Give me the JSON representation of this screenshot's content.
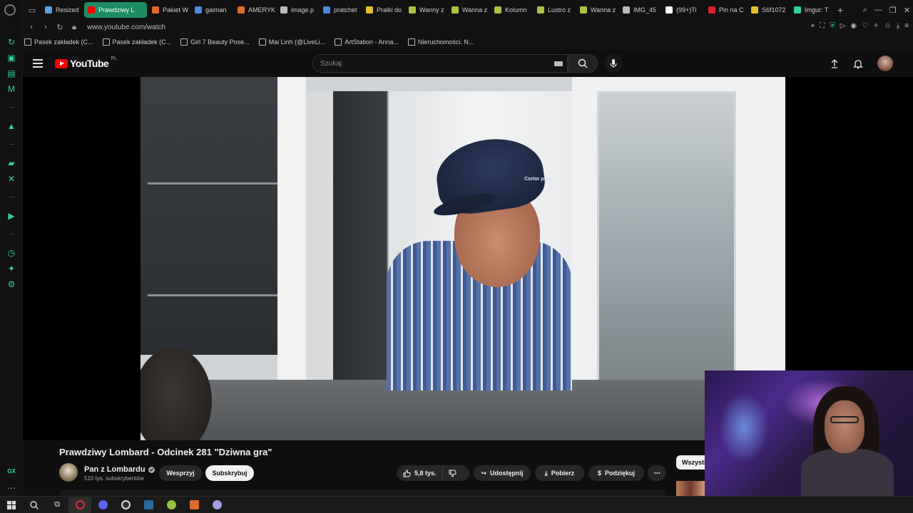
{
  "browser": {
    "tabs": [
      {
        "label": "Resized",
        "color": "#5aa0e0"
      },
      {
        "label": "Prawdziwy L",
        "color": "#ff0000",
        "active": true
      },
      {
        "label": "Pakiet W",
        "color": "#e06a2a"
      },
      {
        "label": "gaiman",
        "color": "#4a8ae0"
      },
      {
        "label": "AMERYK",
        "color": "#e06a2a"
      },
      {
        "label": "image.p",
        "color": "#bbbbbb"
      },
      {
        "label": "pratchet",
        "color": "#4a8ae0"
      },
      {
        "label": "Pralki do",
        "color": "#e0c030"
      },
      {
        "label": "Wanny z",
        "color": "#b0c040"
      },
      {
        "label": "Wanna z",
        "color": "#b0c040"
      },
      {
        "label": "Kolumn",
        "color": "#b0c040"
      },
      {
        "label": "Lustro z",
        "color": "#b0c040"
      },
      {
        "label": "Wanna z",
        "color": "#b0c040"
      },
      {
        "label": "IMG_45",
        "color": "#bbbbbb"
      },
      {
        "label": "(99+)Ti",
        "color": "#ffffff"
      },
      {
        "label": "Pin na C",
        "color": "#e02030"
      },
      {
        "label": "S6f1072",
        "color": "#e0c030"
      },
      {
        "label": "Imgur: T",
        "color": "#2fd39a"
      }
    ],
    "url": "www.youtube.com/watch",
    "bookmarks": [
      "Pasek zakładek (C...",
      "Pasek zakładek (C...",
      "Girl 7 Beauty Pose...",
      "Mai Linh (@LiveLi...",
      "ArtStation - Anna...",
      "Nieruchomości. N..."
    ],
    "sidebar_label": "GX"
  },
  "youtube": {
    "logo_text": "YouTube",
    "country": "PL",
    "search_placeholder": "Szukaj"
  },
  "video": {
    "title": "Prawdziwy Lombard - Odcinek 281 \"Dziwna gra\"",
    "cap_text": "Cortor plus",
    "channel_name": "Pan z Lombardu",
    "subscribers": "510 tys. subskrybentów",
    "support_label": "Wesprzyj",
    "subscribe_label": "Subskrybuj",
    "likes": "5,8 tys.",
    "share_label": "Udostępnij",
    "download_label": "Pobierz",
    "thanks_label": "Podziękuj",
    "filter_label": "Wszystko"
  },
  "colors": {
    "gx_accent": "#2fd39a",
    "active_tab": "#1c8c63",
    "youtube_red": "#ff0000"
  }
}
